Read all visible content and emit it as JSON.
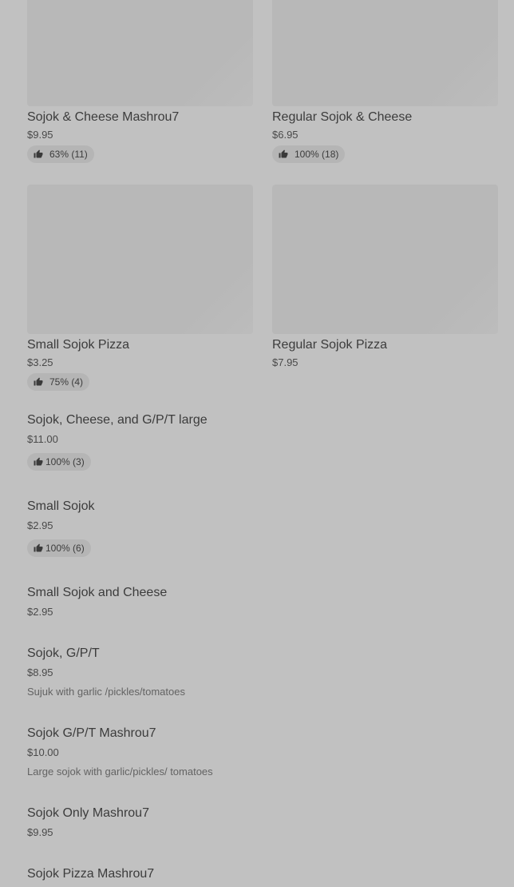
{
  "grid_items": [
    {
      "title": "Sojok & Cheese Mashrou7",
      "price": "$9.95",
      "rating": "63% (11)"
    },
    {
      "title": "Regular Sojok & Cheese",
      "price": "$6.95",
      "rating": "100% (18)"
    },
    {
      "title": "Small Sojok Pizza",
      "price": "$3.25",
      "rating": "75% (4)"
    },
    {
      "title": "Regular Sojok Pizza",
      "price": "$7.95"
    }
  ],
  "list_items": [
    {
      "title": "Sojok, Cheese, and G/P/T large",
      "price": "$11.00",
      "rating": "100% (3)"
    },
    {
      "title": "Small Sojok",
      "price": "$2.95",
      "rating": "100% (6)"
    },
    {
      "title": "Small Sojok and Cheese",
      "price": "$2.95"
    },
    {
      "title": "Sojok, G/P/T",
      "price": "$8.95",
      "description": "Sujuk with garlic /pickles/tomatoes"
    },
    {
      "title": "Sojok G/P/T Mashrou7",
      "price": "$10.00",
      "description": "Large sojok with garlic/pickles/ tomatoes"
    },
    {
      "title": "Sojok Only Mashrou7",
      "price": "$9.95"
    },
    {
      "title": "Sojok Pizza Mashrou7"
    }
  ],
  "icons": {
    "rating": "thumbs-up-icon"
  }
}
